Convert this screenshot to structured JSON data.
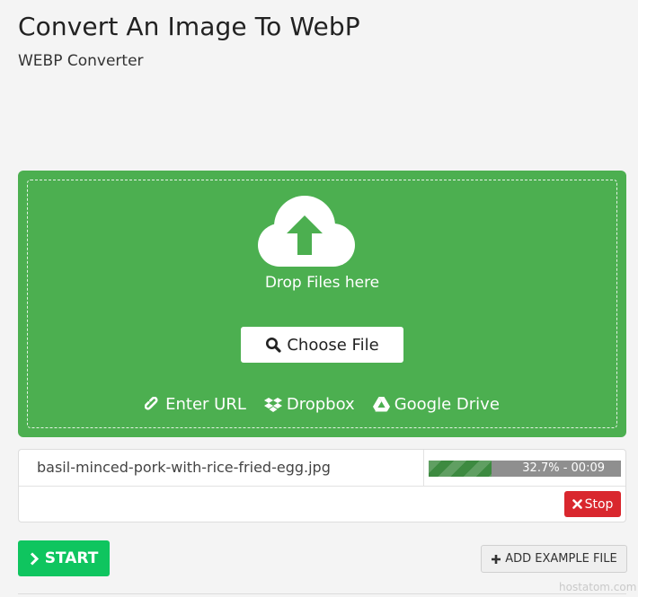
{
  "header": {
    "title": "Convert An Image To WebP",
    "subtitle": "WEBP Converter"
  },
  "dropzone": {
    "icon": "cloud-upload-icon",
    "drop_text": "Drop Files here",
    "choose_file_label": "Choose File",
    "sources": [
      {
        "label": "Enter URL",
        "icon": "link-icon"
      },
      {
        "label": "Dropbox",
        "icon": "dropbox-icon"
      },
      {
        "label": "Google Drive",
        "icon": "google-drive-icon"
      }
    ],
    "bg_color": "#4caf50"
  },
  "file": {
    "name": "basil-minced-pork-with-rice-fried-egg.jpg",
    "progress_percent": 32.7,
    "progress_text": "32.7% - 00:09",
    "stop_label": "Stop"
  },
  "actions": {
    "start_label": "START",
    "example_label": "ADD EXAMPLE FILE",
    "start_color": "#0fc55f",
    "stop_color": "#d9272e"
  },
  "watermark": "hostatom.com"
}
